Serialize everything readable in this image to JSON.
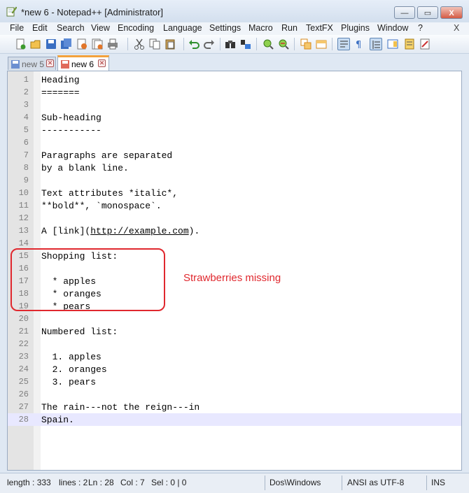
{
  "window": {
    "title": "*new  6 - Notepad++ [Administrator]",
    "controls": {
      "minimize": "—",
      "maximize": "▭",
      "close": "X"
    }
  },
  "menu": [
    "File",
    "Edit",
    "Search",
    "View",
    "Encoding",
    "Language",
    "Settings",
    "Macro",
    "Run",
    "TextFX",
    "Plugins",
    "Window",
    "?"
  ],
  "menu_close": "X",
  "toolbar_icons": [
    "new-file-icon",
    "open-file-icon",
    "save-icon",
    "save-all-icon",
    "close-icon",
    "close-all-icon",
    "print-icon",
    "cut-icon",
    "copy-icon",
    "paste-icon",
    "undo-icon",
    "redo-icon",
    "find-icon",
    "replace-icon",
    "zoom-in-icon",
    "zoom-out-icon",
    "sync-vertical-icon",
    "sync-horizontal-icon",
    "word-wrap-icon",
    "show-all-chars-icon",
    "indent-guide-icon",
    "document-map-icon",
    "function-list-icon",
    "spellcheck-icon"
  ],
  "tabs": [
    {
      "label": "new  5",
      "active": false
    },
    {
      "label": "new  6",
      "active": true
    }
  ],
  "lines": [
    "Heading",
    "=======",
    "",
    "Sub-heading",
    "-----------",
    "",
    "Paragraphs are separated",
    "by a blank line.",
    "",
    "Text attributes *italic*,",
    "**bold**, `monospace`.",
    "",
    "A [link](http://example.com).",
    "",
    "Shopping list:",
    "",
    "  * apples",
    "  * oranges",
    "  * pears",
    "",
    "Numbered list:",
    "",
    "  1. apples",
    "  2. oranges",
    "  3. pears",
    "",
    "The rain---not the reign---in",
    "Spain."
  ],
  "current_line": 28,
  "annotation": "Strawberries missing",
  "status": {
    "length": "length : 333",
    "lines": "lines : 2",
    "ln": "Ln : 28",
    "col": "Col : 7",
    "sel": "Sel : 0 | 0",
    "eol": "Dos\\Windows",
    "encoding": "ANSI as UTF-8",
    "mode": "INS"
  },
  "colors": {
    "annotation": "#e0282e",
    "tab_accent": "#f4a23c",
    "current_line": "#e8e8ff"
  }
}
